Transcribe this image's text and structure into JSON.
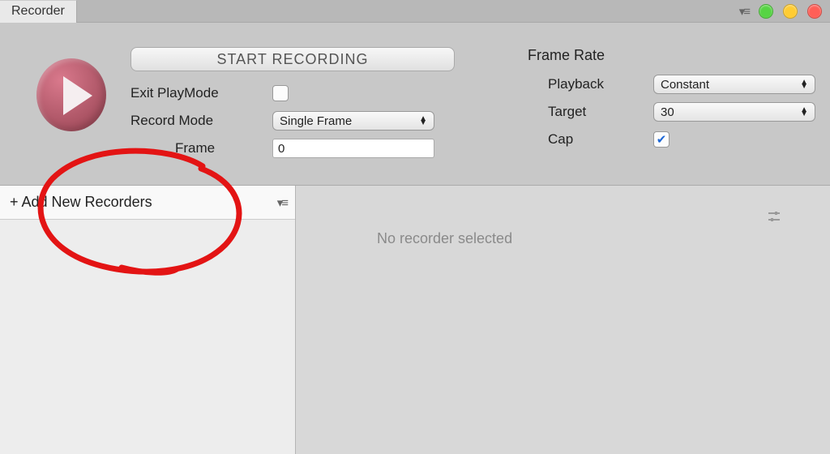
{
  "titlebar": {
    "tab": "Recorder"
  },
  "controls": {
    "start_label": "START RECORDING",
    "exit_playmode_label": "Exit PlayMode",
    "exit_playmode_checked": false,
    "record_mode_label": "Record Mode",
    "record_mode_value": "Single Frame",
    "frame_label": "Frame",
    "frame_value": "0"
  },
  "framerate": {
    "section_title": "Frame Rate",
    "playback_label": "Playback",
    "playback_value": "Constant",
    "target_label": "Target",
    "target_value": "30",
    "cap_label": "Cap",
    "cap_checked": true
  },
  "sidebar": {
    "add_label": "+ Add New Recorders"
  },
  "main": {
    "empty_text": "No recorder selected"
  },
  "icons": {
    "check": "✔",
    "popup": "▾≡"
  }
}
